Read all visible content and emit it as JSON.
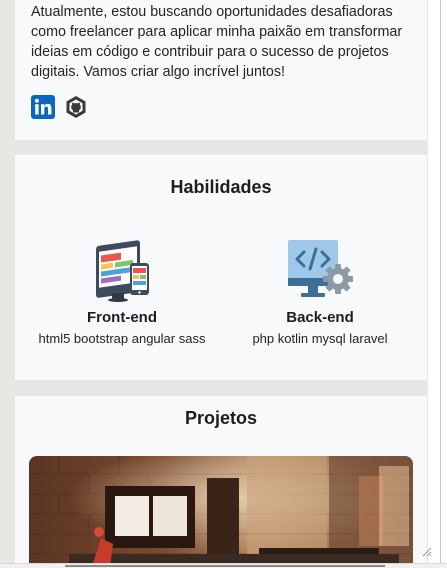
{
  "about": {
    "text": "Atualmente, estou buscando oportunidades desafiadoras como freelancer para aplicar minha paixão em transformar ideias em código e contribuir para o sucesso de projetos digitais.  Vamos criar algo incrível juntos!",
    "social": [
      "linkedin-icon",
      "github-icon"
    ]
  },
  "skills": {
    "title": "Habilidades",
    "items": [
      {
        "name": "Front-end",
        "tags": "html5 bootstrap angular sass",
        "icon": "responsive-devices-icon"
      },
      {
        "name": "Back-end",
        "tags": "php kotlin mysql laravel",
        "icon": "code-monitor-gear-icon"
      }
    ]
  },
  "projects": {
    "title": "Projetos"
  },
  "colors": {
    "page_bg": "#e9e7e4",
    "card_bg": "#f8f9fa",
    "linkedin": "#0a66c2",
    "text": "#212529"
  }
}
